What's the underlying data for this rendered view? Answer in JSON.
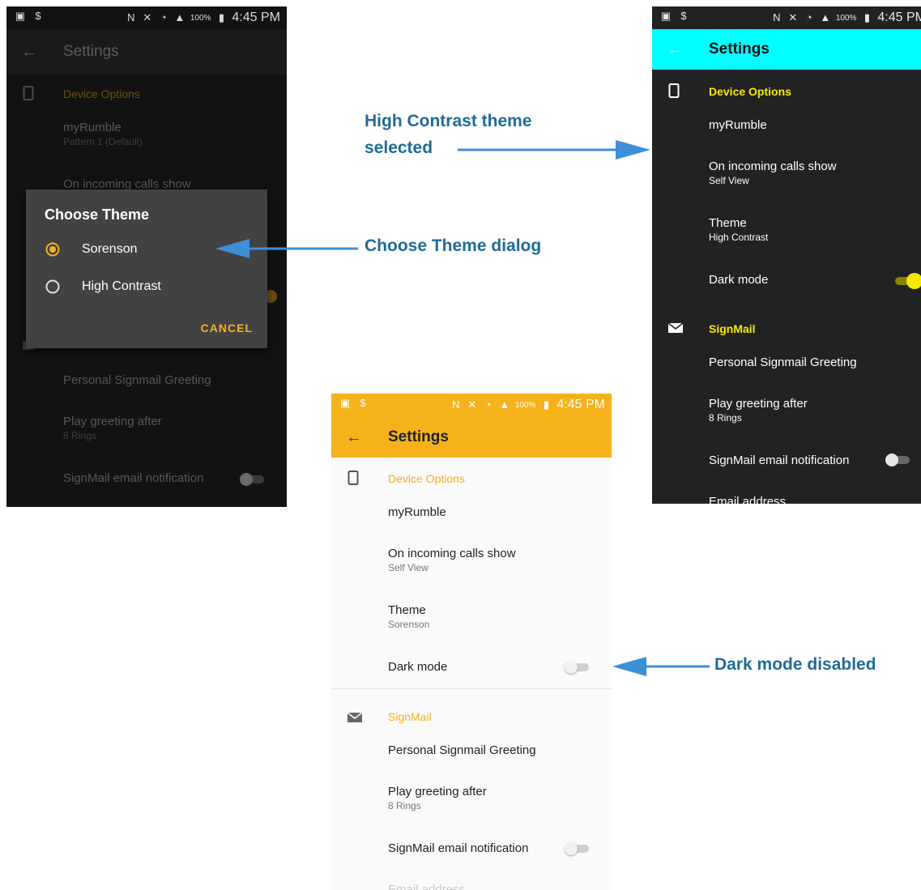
{
  "status": {
    "battery": "100%",
    "time": "4:45 PM"
  },
  "annotations": {
    "high_contrast_line1": "High Contrast theme",
    "high_contrast_line2": "selected",
    "choose_theme": "Choose Theme dialog",
    "dark_mode_disabled": "Dark mode disabled"
  },
  "colors": {
    "sorenson_accent": "#f6b21a",
    "high_contrast_accent": "#00ffff",
    "high_contrast_text": "#f3ea00",
    "annotation": "#1f6c96",
    "arrow": "#3d8fd8"
  },
  "screen1": {
    "title": "Settings",
    "section_device": "Device Options",
    "myrumble": "myRumble",
    "myrumble_sub": "Pattern 1 (Default)",
    "incoming": "On incoming calls show",
    "personal_greeting": "Personal Signmail Greeting",
    "play_greeting": "Play greeting after",
    "play_greeting_sub": "8 Rings",
    "email_notification": "SignMail email notification",
    "dialog": {
      "title": "Choose Theme",
      "options": [
        "Sorenson",
        "High Contrast"
      ],
      "selected": "Sorenson",
      "cancel": "CANCEL"
    }
  },
  "screen2": {
    "title": "Settings",
    "section_device": "Device Options",
    "myrumble": "myRumble",
    "incoming": "On incoming calls show",
    "incoming_sub": "Self View",
    "theme": "Theme",
    "theme_sub": "High Contrast",
    "dark_mode": "Dark mode",
    "dark_mode_on": true,
    "section_signmail": "SignMail",
    "personal_greeting": "Personal Signmail Greeting",
    "play_greeting": "Play greeting after",
    "play_greeting_sub": "8 Rings",
    "email_notification": "SignMail email notification",
    "email_address": "Email address"
  },
  "screen3": {
    "title": "Settings",
    "section_device": "Device Options",
    "myrumble": "myRumble",
    "incoming": "On incoming calls show",
    "incoming_sub": "Self View",
    "theme": "Theme",
    "theme_sub": "Sorenson",
    "dark_mode": "Dark mode",
    "dark_mode_on": false,
    "section_signmail": "SignMail",
    "personal_greeting": "Personal Signmail Greeting",
    "play_greeting": "Play greeting after",
    "play_greeting_sub": "8 Rings",
    "email_notification": "SignMail email notification",
    "email_address": "Email address"
  }
}
